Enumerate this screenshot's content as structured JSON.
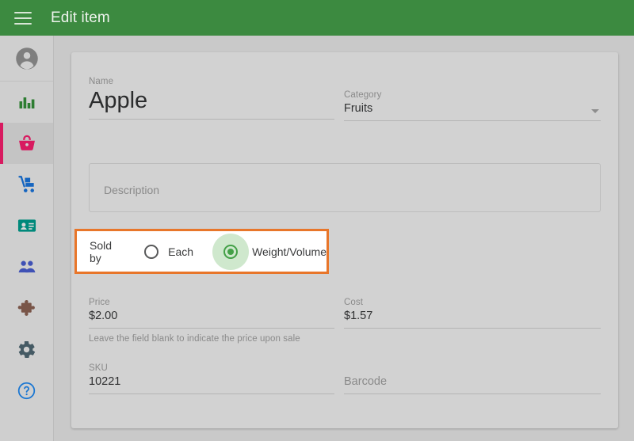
{
  "appbar": {
    "menu_icon": "hamburger-menu-icon",
    "title": "Edit item",
    "background_color": "#3c8a40"
  },
  "sidebar": {
    "background_color": "#cfcfcf",
    "active_indicator_color": "#d81b60",
    "items": [
      {
        "name": "profile",
        "icon": "user-avatar-icon",
        "color": "#7f7f7f",
        "active": false
      },
      {
        "name": "reports",
        "icon": "bar-chart-icon",
        "color": "#2e7d32",
        "active": false
      },
      {
        "name": "items",
        "icon": "shopping-basket-icon",
        "color": "#d81b60",
        "active": true
      },
      {
        "name": "inventory",
        "icon": "hand-truck-icon",
        "color": "#1565c0",
        "active": false
      },
      {
        "name": "employees",
        "icon": "id-card-icon",
        "color": "#00897b",
        "active": false
      },
      {
        "name": "customers",
        "icon": "people-icon",
        "color": "#3f51b5",
        "active": false
      },
      {
        "name": "integrations",
        "icon": "puzzle-piece-icon",
        "color": "#795548",
        "active": false
      },
      {
        "name": "settings",
        "icon": "gear-icon",
        "color": "#455a64",
        "active": false
      },
      {
        "name": "help",
        "icon": "help-circle-icon",
        "color": "#1976d2",
        "active": false
      }
    ]
  },
  "form": {
    "name": {
      "label": "Name",
      "value": "Apple"
    },
    "category": {
      "label": "Category",
      "value": "Fruits",
      "dropdown_icon": "chevron-down-icon"
    },
    "description": {
      "placeholder": "Description",
      "value": ""
    },
    "sold_by": {
      "label": "Sold by",
      "highlight_color": "#e8762a",
      "selected": "Weight/Volume",
      "options": [
        {
          "label": "Each",
          "selected": false
        },
        {
          "label": "Weight/Volume",
          "selected": true
        }
      ]
    },
    "price": {
      "label": "Price",
      "value": "$2.00",
      "help": "Leave the field blank to indicate the price upon sale"
    },
    "cost": {
      "label": "Cost",
      "value": "$1.57"
    },
    "sku": {
      "label": "SKU",
      "value": "10221"
    },
    "barcode": {
      "label": "",
      "placeholder": "Barcode",
      "value": ""
    }
  }
}
